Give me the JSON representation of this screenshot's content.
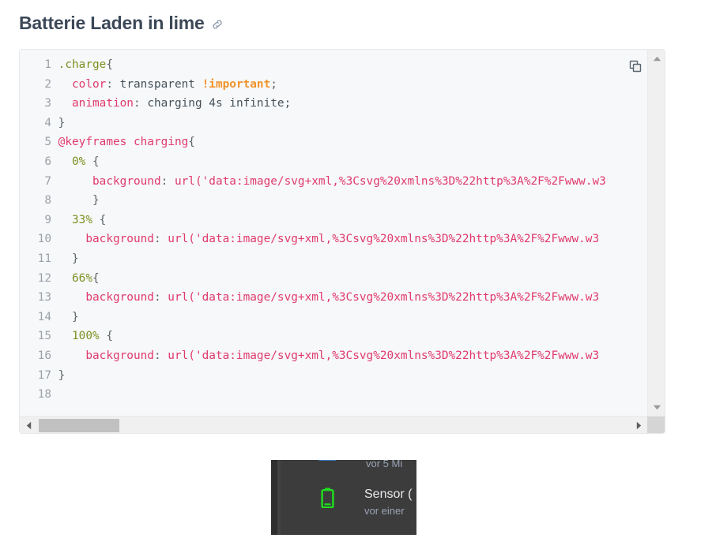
{
  "header": {
    "title": "Batterie Laden in lime",
    "anchor_icon": "link-icon"
  },
  "code_block": {
    "language": "css",
    "copy_icon": "copy-icon",
    "scroll_up_icon": "chevron-up-icon",
    "scroll_down_icon": "chevron-down-icon",
    "scroll_left_icon": "triangle-left-icon",
    "scroll_right_icon": "triangle-right-icon",
    "colors": {
      "background": "#f7f8f9",
      "line_number": "#9aa1a8",
      "selector": "#7c9022",
      "at_rule": "#e03a6d",
      "property": "#e03a6d",
      "value": "#44515a",
      "important": "#f0932b",
      "string": "#e03a6d",
      "scrollbar_thumb": "#c1c1c1"
    },
    "lines": [
      {
        "n": "1",
        "tokens": [
          {
            "t": ".charge",
            "c": "t-sel"
          },
          {
            "t": "{",
            "c": "t-punc"
          }
        ]
      },
      {
        "n": "2",
        "tokens": [
          {
            "t": "  ",
            "c": "t-punc"
          },
          {
            "t": "color",
            "c": "t-prop"
          },
          {
            "t": ": ",
            "c": "t-punc"
          },
          {
            "t": "transparent ",
            "c": "t-val"
          },
          {
            "t": "!important",
            "c": "t-imp"
          },
          {
            "t": ";",
            "c": "t-punc"
          }
        ]
      },
      {
        "n": "3",
        "tokens": [
          {
            "t": "  ",
            "c": "t-punc"
          },
          {
            "t": "animation",
            "c": "t-prop"
          },
          {
            "t": ": ",
            "c": "t-punc"
          },
          {
            "t": "charging 4s infinite;",
            "c": "t-val"
          }
        ]
      },
      {
        "n": "4",
        "tokens": [
          {
            "t": "}",
            "c": "t-punc"
          }
        ]
      },
      {
        "n": "5",
        "tokens": [
          {
            "t": "@keyframes charging",
            "c": "t-at"
          },
          {
            "t": "{",
            "c": "t-punc"
          }
        ]
      },
      {
        "n": "6",
        "tokens": [
          {
            "t": "  ",
            "c": "t-punc"
          },
          {
            "t": "0%",
            "c": "t-pct"
          },
          {
            "t": " {",
            "c": "t-punc"
          }
        ]
      },
      {
        "n": "7",
        "tokens": [
          {
            "t": "     ",
            "c": "t-punc"
          },
          {
            "t": "background",
            "c": "t-prop"
          },
          {
            "t": ": ",
            "c": "t-punc"
          },
          {
            "t": "url('data:image/svg+xml,%3Csvg%20xmlns%3D%22http%3A%2F%2Fwww.w3",
            "c": "t-str"
          }
        ]
      },
      {
        "n": "8",
        "tokens": [
          {
            "t": "     }",
            "c": "t-punc"
          }
        ]
      },
      {
        "n": "9",
        "tokens": [
          {
            "t": "  ",
            "c": "t-punc"
          },
          {
            "t": "33%",
            "c": "t-pct"
          },
          {
            "t": " {",
            "c": "t-punc"
          }
        ]
      },
      {
        "n": "10",
        "tokens": [
          {
            "t": "    ",
            "c": "t-punc"
          },
          {
            "t": "background",
            "c": "t-prop"
          },
          {
            "t": ": ",
            "c": "t-punc"
          },
          {
            "t": "url('data:image/svg+xml,%3Csvg%20xmlns%3D%22http%3A%2F%2Fwww.w3",
            "c": "t-str"
          }
        ]
      },
      {
        "n": "11",
        "tokens": [
          {
            "t": "  }",
            "c": "t-punc"
          }
        ]
      },
      {
        "n": "12",
        "tokens": [
          {
            "t": "  ",
            "c": "t-punc"
          },
          {
            "t": "66%",
            "c": "t-pct"
          },
          {
            "t": "{",
            "c": "t-punc"
          }
        ]
      },
      {
        "n": "13",
        "tokens": [
          {
            "t": "    ",
            "c": "t-punc"
          },
          {
            "t": "background",
            "c": "t-prop"
          },
          {
            "t": ": ",
            "c": "t-punc"
          },
          {
            "t": "url('data:image/svg+xml,%3Csvg%20xmlns%3D%22http%3A%2F%2Fwww.w3",
            "c": "t-str"
          }
        ]
      },
      {
        "n": "14",
        "tokens": [
          {
            "t": "  }",
            "c": "t-punc"
          }
        ]
      },
      {
        "n": "15",
        "tokens": [
          {
            "t": "  ",
            "c": "t-punc"
          },
          {
            "t": "100%",
            "c": "t-pct"
          },
          {
            "t": " {",
            "c": "t-punc"
          }
        ]
      },
      {
        "n": "16",
        "tokens": [
          {
            "t": "    ",
            "c": "t-punc"
          },
          {
            "t": "background",
            "c": "t-prop"
          },
          {
            "t": ": ",
            "c": "t-punc"
          },
          {
            "t": "url('data:image/svg+xml,%3Csvg%20xmlns%3D%22http%3A%2F%2Fwww.w3",
            "c": "t-str"
          }
        ]
      },
      {
        "n": "17",
        "tokens": [
          {
            "t": "}",
            "c": "t-punc"
          }
        ]
      },
      {
        "n": "18",
        "tokens": []
      }
    ]
  },
  "screenshot": {
    "alt": "Screenshot einer dunklen Sensorliste mit limegrünem Batteriesymbol",
    "background_color": "#3c3c3c",
    "battery_color": "#1fe01f",
    "battery_icon": "battery-icon",
    "top_text": "vor 5 Mi",
    "entry_title": "Sensor (",
    "entry_subtitle": "vor einer"
  }
}
